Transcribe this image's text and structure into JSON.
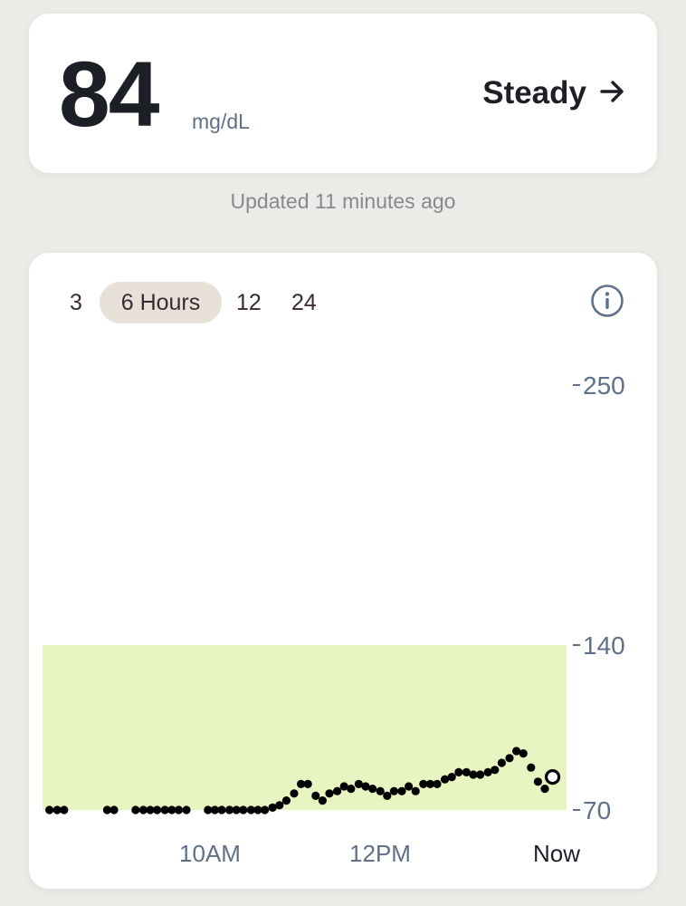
{
  "reading": {
    "value": "84",
    "unit": "mg/dL",
    "trend_label": "Steady",
    "trend_icon": "arrow-right-icon"
  },
  "updated_text": "Updated 11 minutes ago",
  "range_selector": {
    "options": [
      "3",
      "6 Hours",
      "12",
      "24"
    ],
    "selected": "6 Hours"
  },
  "info_icon": "info-icon",
  "colors": {
    "target_band": "#e8f4c2",
    "dot": "#000000",
    "selected_pill": "#e8e1d7",
    "axis_text": "#5f7088"
  },
  "chart_data": {
    "type": "scatter",
    "title": "",
    "xlabel": "",
    "ylabel": "",
    "x_ticks": [
      "10AM",
      "12PM",
      "Now"
    ],
    "y_ticks": [
      70,
      140,
      250
    ],
    "ylim": [
      70,
      250
    ],
    "target_range": [
      70,
      140
    ],
    "x_unit": "hours",
    "xlim": [
      0,
      6
    ],
    "series": [
      {
        "values": [
          {
            "x": 0.08,
            "y": 70
          },
          {
            "x": 0.17,
            "y": 70
          },
          {
            "x": 0.25,
            "y": 70
          },
          {
            "x": 0.75,
            "y": 70
          },
          {
            "x": 0.83,
            "y": 70
          },
          {
            "x": 1.08,
            "y": 70
          },
          {
            "x": 1.17,
            "y": 70
          },
          {
            "x": 1.25,
            "y": 70
          },
          {
            "x": 1.33,
            "y": 70
          },
          {
            "x": 1.42,
            "y": 70
          },
          {
            "x": 1.5,
            "y": 70
          },
          {
            "x": 1.58,
            "y": 70
          },
          {
            "x": 1.67,
            "y": 70
          },
          {
            "x": 1.92,
            "y": 70
          },
          {
            "x": 2.0,
            "y": 70
          },
          {
            "x": 2.08,
            "y": 70
          },
          {
            "x": 2.17,
            "y": 70
          },
          {
            "x": 2.25,
            "y": 70
          },
          {
            "x": 2.33,
            "y": 70
          },
          {
            "x": 2.42,
            "y": 70
          },
          {
            "x": 2.5,
            "y": 70
          },
          {
            "x": 2.58,
            "y": 70
          },
          {
            "x": 2.67,
            "y": 71
          },
          {
            "x": 2.75,
            "y": 72
          },
          {
            "x": 2.83,
            "y": 74
          },
          {
            "x": 2.92,
            "y": 77
          },
          {
            "x": 3.0,
            "y": 81
          },
          {
            "x": 3.08,
            "y": 81
          },
          {
            "x": 3.17,
            "y": 76
          },
          {
            "x": 3.25,
            "y": 74
          },
          {
            "x": 3.33,
            "y": 77
          },
          {
            "x": 3.42,
            "y": 78
          },
          {
            "x": 3.5,
            "y": 80
          },
          {
            "x": 3.58,
            "y": 79
          },
          {
            "x": 3.67,
            "y": 81
          },
          {
            "x": 3.75,
            "y": 80
          },
          {
            "x": 3.83,
            "y": 79
          },
          {
            "x": 3.92,
            "y": 78
          },
          {
            "x": 4.0,
            "y": 76
          },
          {
            "x": 4.08,
            "y": 78
          },
          {
            "x": 4.17,
            "y": 78
          },
          {
            "x": 4.25,
            "y": 80
          },
          {
            "x": 4.33,
            "y": 78
          },
          {
            "x": 4.42,
            "y": 81
          },
          {
            "x": 4.5,
            "y": 81
          },
          {
            "x": 4.58,
            "y": 81
          },
          {
            "x": 4.67,
            "y": 83
          },
          {
            "x": 4.75,
            "y": 84
          },
          {
            "x": 4.83,
            "y": 86
          },
          {
            "x": 4.92,
            "y": 86
          },
          {
            "x": 5.0,
            "y": 85
          },
          {
            "x": 5.08,
            "y": 85
          },
          {
            "x": 5.17,
            "y": 86
          },
          {
            "x": 5.25,
            "y": 87
          },
          {
            "x": 5.33,
            "y": 90
          },
          {
            "x": 5.42,
            "y": 92
          },
          {
            "x": 5.5,
            "y": 95
          },
          {
            "x": 5.58,
            "y": 94
          },
          {
            "x": 5.67,
            "y": 88
          },
          {
            "x": 5.75,
            "y": 82
          },
          {
            "x": 5.83,
            "y": 79
          }
        ]
      }
    ],
    "current_point": {
      "x": 5.92,
      "y": 84
    }
  }
}
